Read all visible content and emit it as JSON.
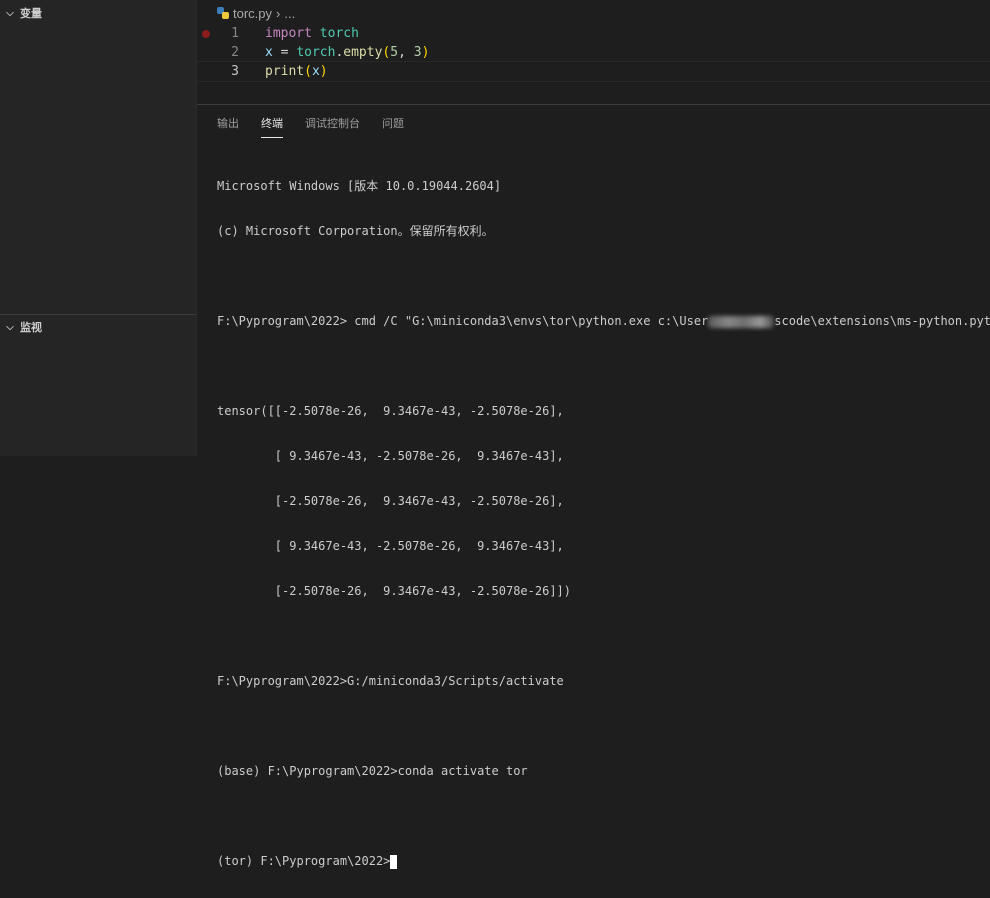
{
  "sidebar": {
    "variables_label": "变量",
    "watch_label": "监视"
  },
  "editor": {
    "breadcrumb_file": "torc.py",
    "breadcrumb_more": "...",
    "line_numbers": [
      "1",
      "2",
      "3"
    ]
  },
  "panel": {
    "tabs": [
      "输出",
      "终端",
      "调试控制台",
      "问题"
    ],
    "active_tab": "终端"
  },
  "terminal": {
    "lines": [
      "Microsoft Windows [版本 10.0.19044.2604]",
      "(c) Microsoft Corporation。保留所有权利。",
      "",
      "",
      "",
      "tensor([[-2.5078e-26,  9.3467e-43, -2.5078e-26],",
      "        [ 9.3467e-43, -2.5078e-26,  9.3467e-43],",
      "        [-2.5078e-26,  9.3467e-43, -2.5078e-26],",
      "        [ 9.3467e-43, -2.5078e-26,  9.3467e-43],",
      "        [-2.5078e-26,  9.3467e-43, -2.5078e-26]])",
      "",
      "F:\\Pyprogram\\2022>G:/miniconda3/Scripts/activate",
      "",
      "(base) F:\\Pyprogram\\2022>conda activate tor",
      ""
    ],
    "cmd_prefix": "F:\\Pyprogram\\2022> cmd /C \"G:\\miniconda3\\envs\\tor\\python.exe c:\\User",
    "cmd_suffix": "scode\\extensions\\ms-python.pytho",
    "prompt": "(tor) F:\\Pyprogram\\2022>"
  }
}
